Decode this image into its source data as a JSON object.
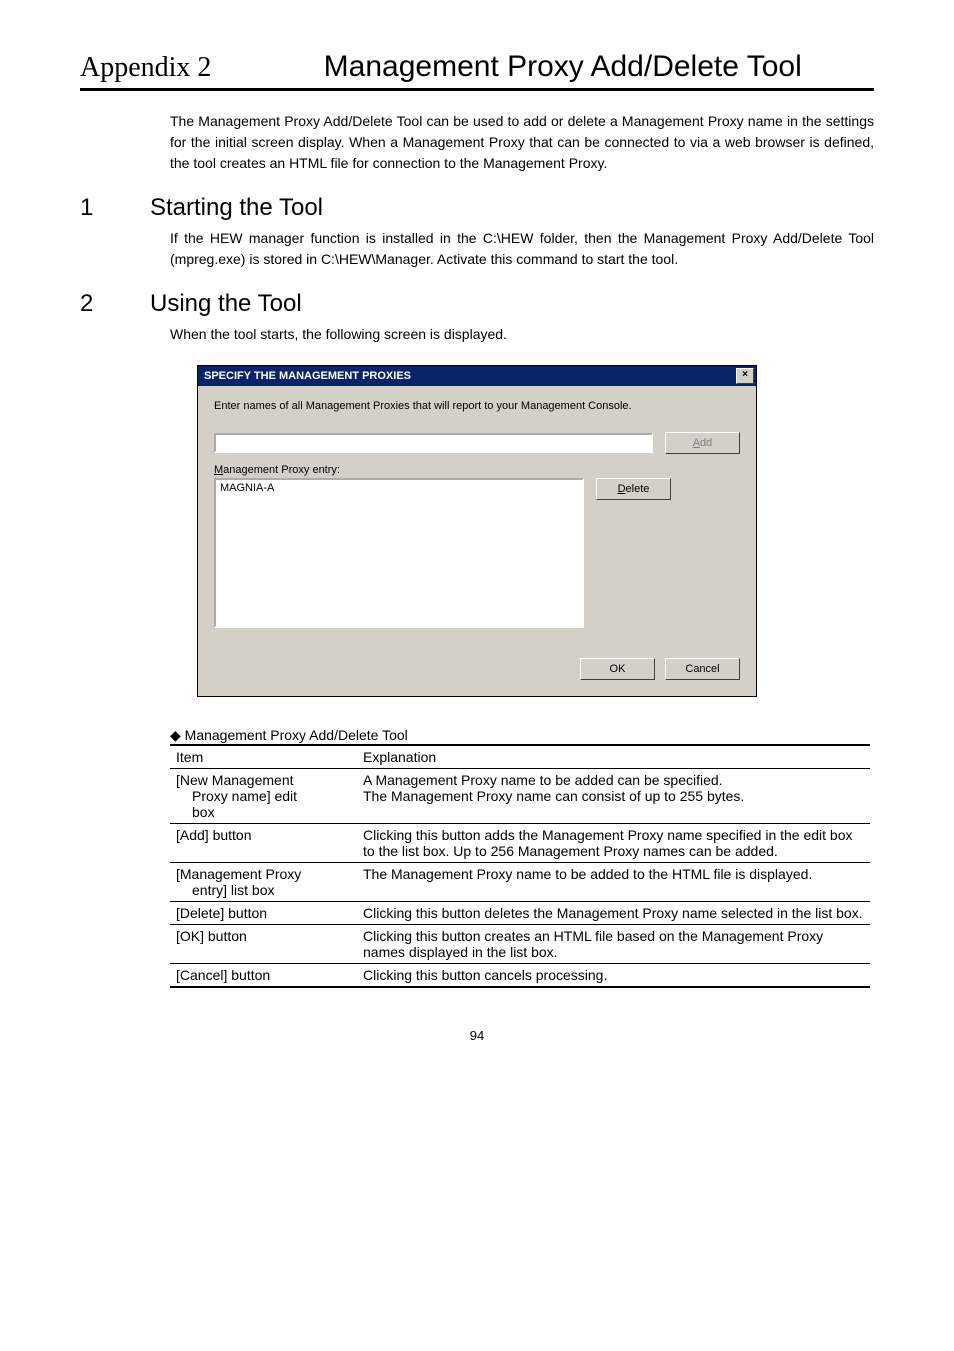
{
  "header": {
    "appendix": "Appendix 2",
    "title": "Management Proxy Add/Delete Tool"
  },
  "intro": "The Management Proxy Add/Delete Tool can be used to add or delete a Management Proxy name in the settings for the initial screen display.   When a Management Proxy that can be connected to via a web browser is defined, the tool creates an HTML file for connection to the Management Proxy.",
  "section1": {
    "num": "1",
    "title": "Starting the Tool",
    "text": "If the HEW manager function is installed in the C:\\HEW folder, then the Management Proxy Add/Delete Tool (mpreg.exe) is stored in C:\\HEW\\Manager.   Activate this command to start the tool."
  },
  "section2": {
    "num": "2",
    "title": "Using the Tool",
    "text": "When the tool starts, the following screen is displayed."
  },
  "dialog": {
    "title": "SPECIFY THE MANAGEMENT PROXIES",
    "close": "×",
    "instruction": "Enter names of all Management Proxies that will report to your Management Console.",
    "add_btn_prefix": "A",
    "add_btn_rest": "dd",
    "list_label_prefix": "M",
    "list_label_rest": "anagement Proxy entry:",
    "list_item": "MAGNIA-A",
    "delete_btn_prefix": "D",
    "delete_btn_rest": "elete",
    "ok_btn": "OK",
    "cancel_btn": "Cancel"
  },
  "table": {
    "caption_prefix": "◆ ",
    "caption": "Management Proxy Add/Delete Tool",
    "header_item": "Item",
    "header_exp": "Explanation",
    "rows": [
      {
        "item_line1": "[New Management",
        "item_line2": "Proxy name] edit",
        "item_line3": "box",
        "exp": "A Management Proxy name to be added can be specified.\nThe Management Proxy name can consist of up to 255 bytes."
      },
      {
        "item_line1": "[Add] button",
        "exp": "Clicking this button adds the Management Proxy name specified in the edit box to the list box.   Up to 256 Management Proxy names can be added."
      },
      {
        "item_line1": "[Management Proxy",
        "item_line2": "entry] list box",
        "exp": "The Management Proxy name to be added to the HTML file is displayed."
      },
      {
        "item_line1": "[Delete] button",
        "exp": "Clicking this button deletes the Management Proxy name selected in the list box."
      },
      {
        "item_line1": "[OK] button",
        "exp": "Clicking this button creates an HTML file based on the Management Proxy names displayed in the list box."
      },
      {
        "item_line1": "[Cancel] button",
        "exp": "Clicking this button cancels processing."
      }
    ]
  },
  "page_number": "94"
}
